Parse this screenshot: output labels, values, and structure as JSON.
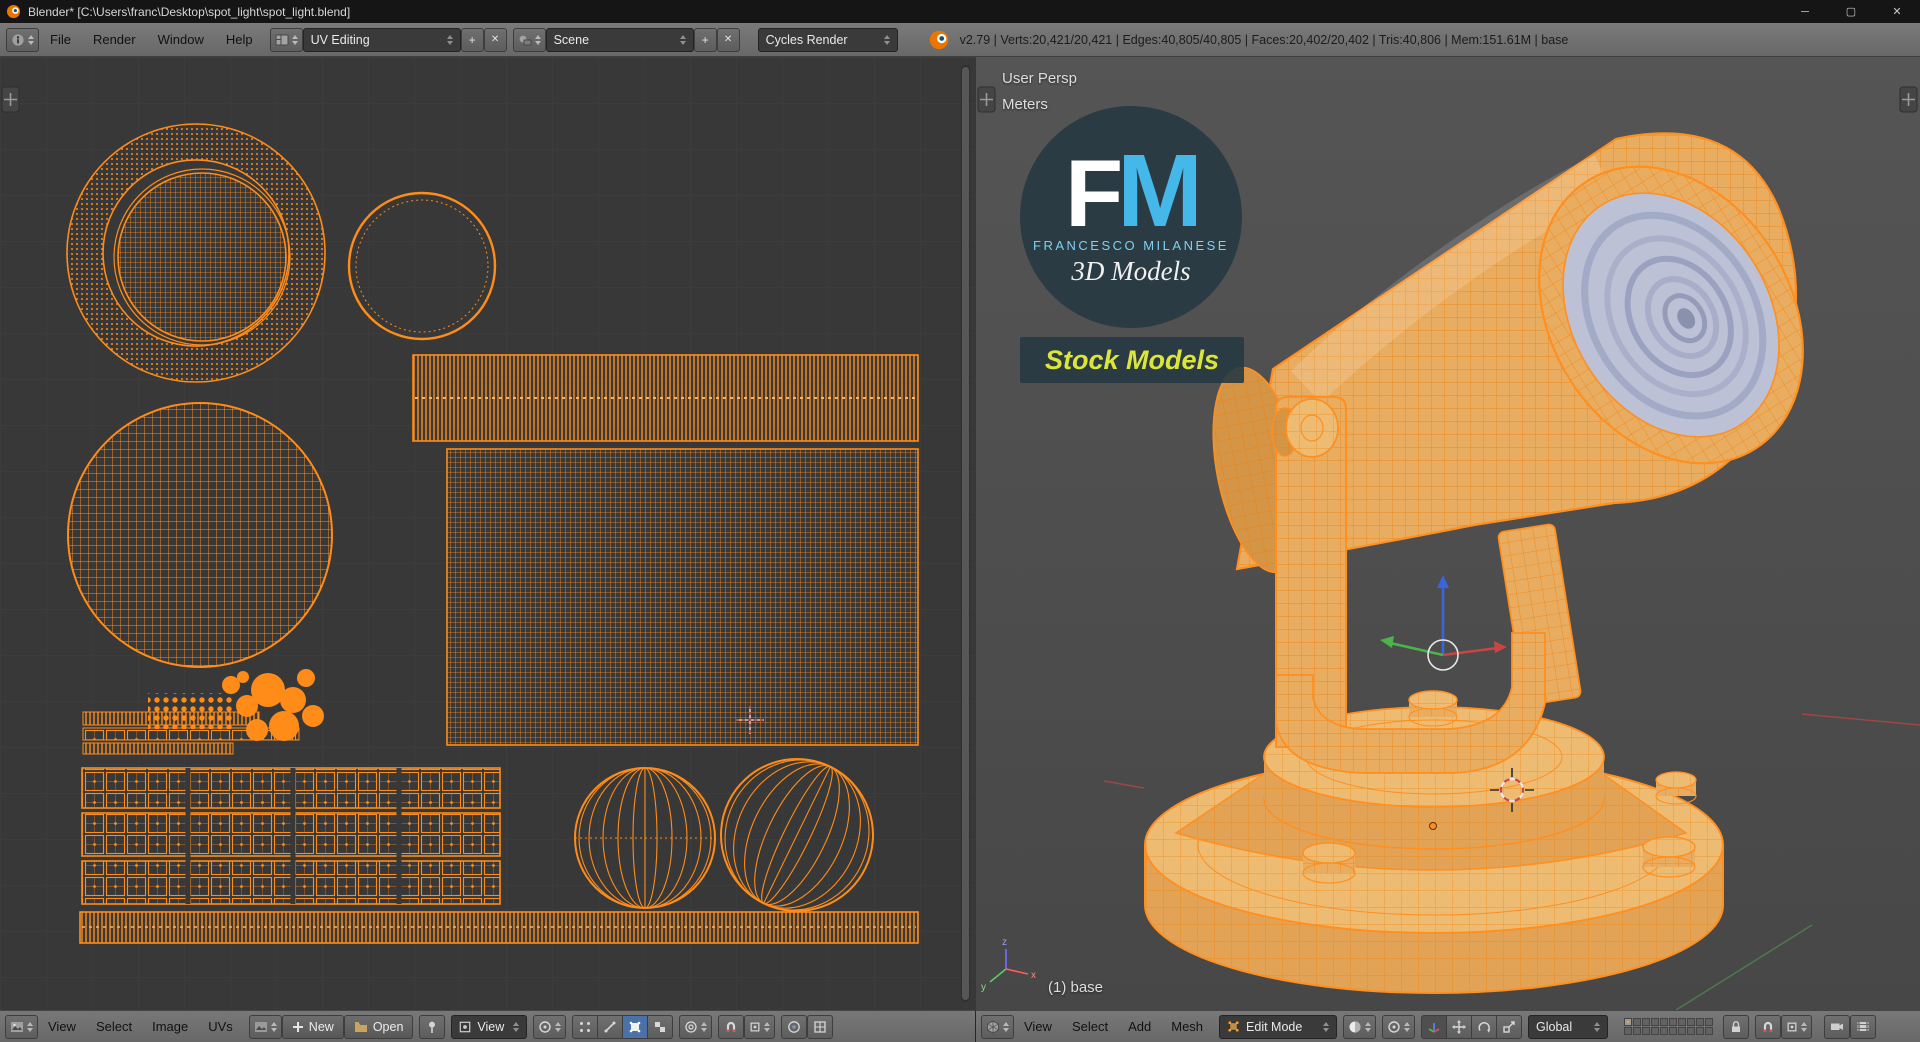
{
  "window": {
    "title": "Blender* [C:\\Users\\franc\\Desktop\\spot_light\\spot_light.blend]",
    "controls": {
      "minimize": "─",
      "maximize": "▢",
      "close": "✕"
    }
  },
  "topbar": {
    "menus": [
      "File",
      "Render",
      "Window",
      "Help"
    ],
    "layout_value": "UV Editing",
    "scene_value": "Scene",
    "engine_value": "Cycles Render",
    "plus": "+",
    "x": "✕",
    "stats": "v2.79 | Verts:20,421/20,421 | Edges:40,805/40,805 | Faces:20,402/20,402 | Tris:40,806 | Mem:151.61M | base"
  },
  "uv": {
    "footer": {
      "menus": [
        "View",
        "Select",
        "Image",
        "UVs"
      ],
      "new_label": "New",
      "open_label": "Open",
      "mode_value": "View"
    }
  },
  "vp": {
    "view_label": "User Persp",
    "units_label": "Meters",
    "object_label": "(1) base",
    "logo": {
      "f": "F",
      "m": "M",
      "name": "FRANCESCO MILANESE",
      "tagline": "3D Models",
      "badge": "Stock Models"
    },
    "footer": {
      "menus": [
        "View",
        "Select",
        "Add",
        "Mesh"
      ],
      "mode_value": "Edit Mode",
      "orientation_value": "Global"
    }
  },
  "colors": {
    "selection_orange": "#ff8c19",
    "mesh_tan": "#e9ad61",
    "lens_gray": "#bcc1d6",
    "logo_blue": "#45b7e8",
    "badge_yellow": "#dce63a"
  }
}
